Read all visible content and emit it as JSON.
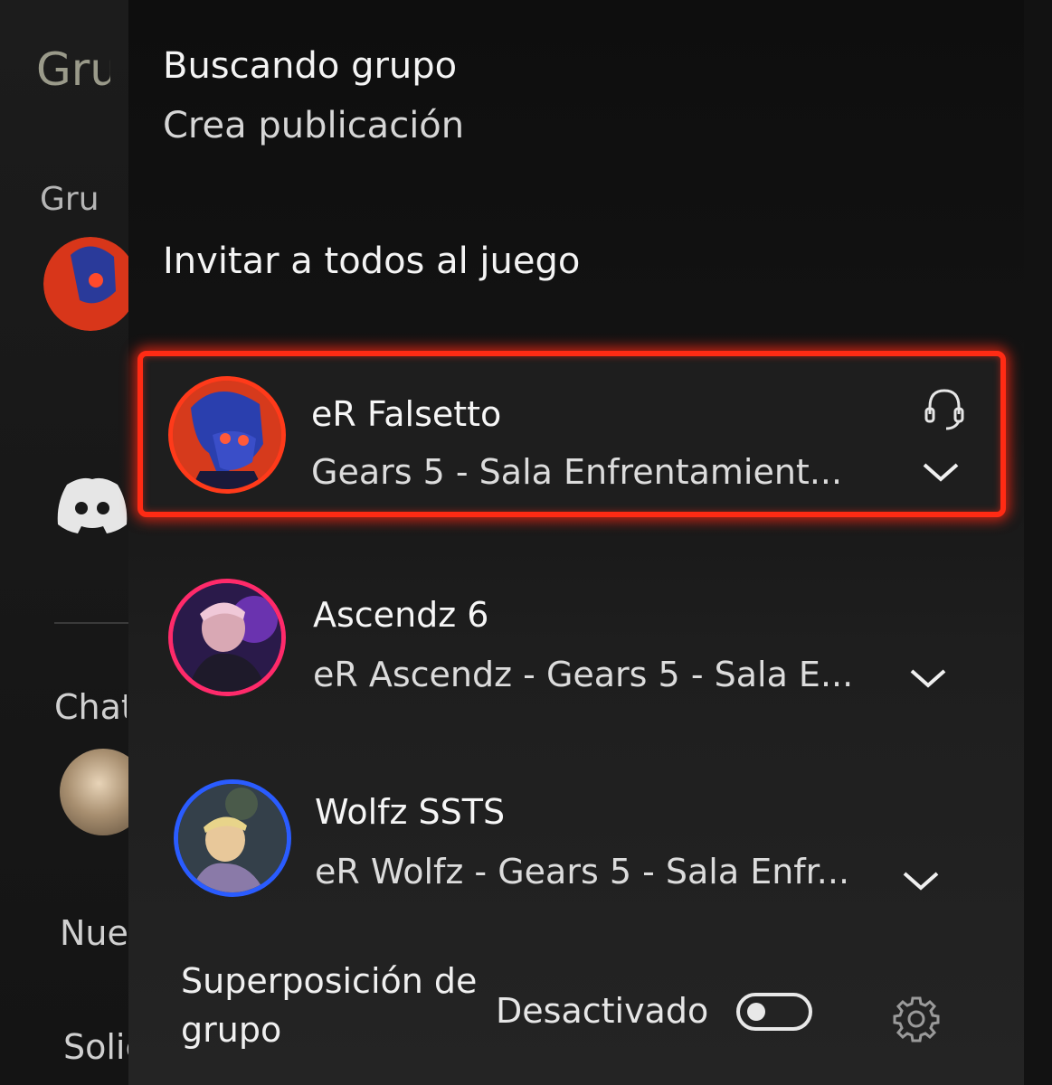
{
  "background": {
    "title_partial": "Gru",
    "section_partial": "Gru",
    "chat_partial": "Chat",
    "new_partial": "Nue",
    "requests_partial": "Solic"
  },
  "menu": {
    "lfg_title": "Buscando grupo",
    "lfg_subtitle": "Crea publicación",
    "invite_all": "Invitar a todos al juego"
  },
  "members": [
    {
      "name": "eR Falsetto",
      "status": "Gears 5 - Sala Enfrentamient...",
      "ring_color": "#ff3a1a",
      "focused": true,
      "headset": true
    },
    {
      "name": "Ascendz 6",
      "status": "eR Ascendz - Gears 5 - Sala E...",
      "ring_color": "#ff2a6a",
      "focused": false,
      "headset": false
    },
    {
      "name": "Wolfz SSTS",
      "status": "eR Wolfz - Gears 5 - Sala Enfr...",
      "ring_color": "#2a5cff",
      "focused": false,
      "headset": false
    }
  ],
  "overlay": {
    "label": "Superposición de grupo",
    "state": "Desactivado"
  },
  "colors": {
    "focus_border": "#ff2b14",
    "background": "#121212"
  }
}
